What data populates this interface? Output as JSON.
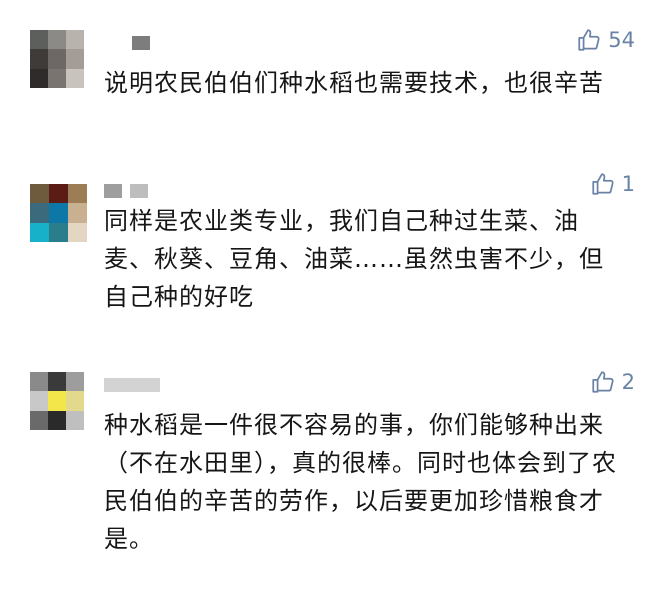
{
  "comments": [
    {
      "likes": "54",
      "text": "说明农民伯伯们种水稻也需要技术，也很辛苦",
      "avatar_colors": [
        "#5d5f5c",
        "#8c8a86",
        "#b8b3ac",
        "#3f3b39",
        "#6d6866",
        "#a49d97",
        "#2f2b2a",
        "#7a7471",
        "#c9c3bd"
      ],
      "name_colors": [
        "#7d7d7d"
      ]
    },
    {
      "likes": "1",
      "text": "同样是农业类专业，我们自己种过生菜、油麦、秋葵、豆角、油菜……虽然虫害不少，但自己种的好吃",
      "avatar_colors": [
        "#6e5a3d",
        "#5b1c15",
        "#9c7d55",
        "#3a6a7c",
        "#0d77a8",
        "#c9b090",
        "#17b1ca",
        "#2a7d8b",
        "#e3d7c3"
      ],
      "name_colors": [
        "#9e9e9e",
        "#bdbdbd"
      ]
    },
    {
      "likes": "2",
      "text": "种水稻是一件很不容易的事，你们能够种出来（不在水田里），真的很棒。同时也体会到了农民伯伯的辛苦的劳作，以后要更加珍惜粮食才是。",
      "avatar_colors": [
        "#8a8a8a",
        "#3a3a3a",
        "#9d9d9d",
        "#c8c8c8",
        "#f3e64a",
        "#e2d98c",
        "#6a6a6a",
        "#2a2a2a",
        "#bfbfbf"
      ],
      "name_colors": [
        "#d3d3d3"
      ]
    }
  ]
}
